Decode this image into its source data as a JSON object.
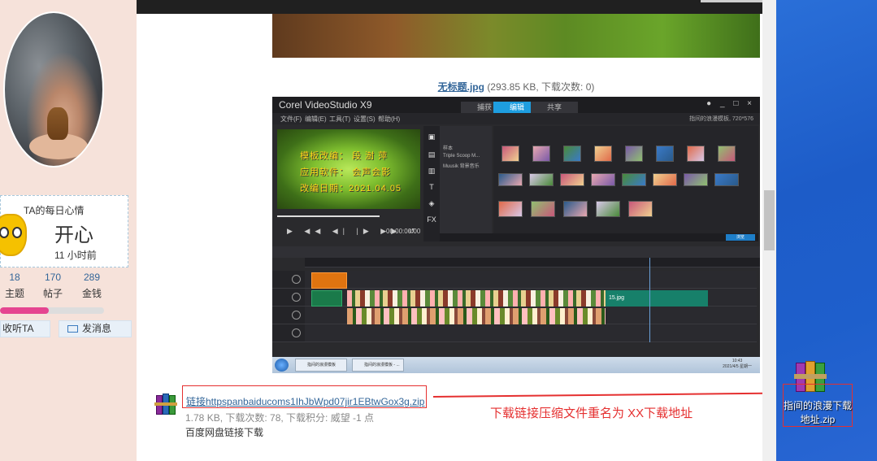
{
  "profile": {
    "mood_title": "TA的每日心情",
    "mood_value": "开心",
    "mood_time": "11 小时前",
    "stats": [
      {
        "num": "18",
        "label": "主题"
      },
      {
        "num": "170",
        "label": "帖子"
      },
      {
        "num": "289",
        "label": "金钱"
      }
    ],
    "progress_fraction": 0.47,
    "listen_label": "收听TA",
    "message_label": "发消息"
  },
  "post": {
    "image_filename": "无标题.jpg",
    "image_meta": "(293.85 KB, 下载次数: 0)"
  },
  "editor": {
    "app_title": "Corel VideoStudio X9",
    "tabs": [
      "捕获",
      "编辑",
      "共享"
    ],
    "active_tab": 1,
    "menus": [
      "文件(F)",
      "编辑(E)",
      "工具(T)",
      "设置(S)",
      "帮助(H)"
    ],
    "status": "指间的浪漫模板, 720*576",
    "preview_lines": [
      "模板改编：  段 澍 萍",
      "应用软件：  会声会影",
      "改编日期：2021.04.05"
    ],
    "timecode": "00:00:00:00",
    "library_items": [
      "样本",
      "Triple Scoop M...",
      "Muusik 背景音乐"
    ],
    "library_button": "浏览",
    "clip_label": "15.jpg",
    "taskbar_items": [
      "指间的浪漫模板",
      "指间的浪漫模板 - ..."
    ],
    "clock_time": "10:43",
    "clock_date": "2021/4/5 星期一"
  },
  "attachment": {
    "link_text": "链接httpspanbaiducoms1IhJbWpd07jir1EBtwGox3g.zip",
    "meta": "1.78 KB, 下载次数: 78, 下载积分: 威望 -1 点",
    "description": "百度网盘链接下载",
    "annotation": "下载链接压缩文件重名为  XX下载地址"
  },
  "desktop": {
    "icon_label": "指间的浪漫下载地址.zip"
  },
  "colors": {
    "link": "#336699",
    "annotation_red": "#e53030",
    "progress_pink": "#e54590",
    "desktop_blue": "#1d5cc8"
  }
}
